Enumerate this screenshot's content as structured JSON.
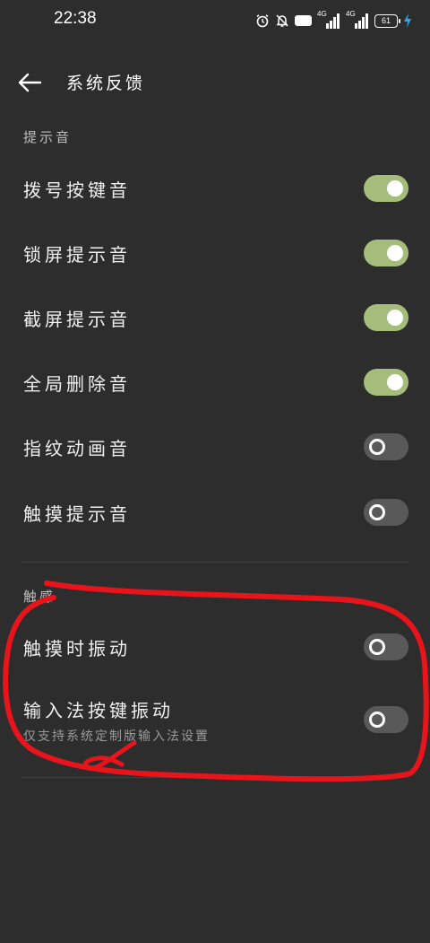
{
  "status_bar": {
    "time": "22:38",
    "icons": [
      "alarm-icon",
      "mute-icon",
      "hd-icon",
      "signal-4g-icon",
      "signal-4g-icon",
      "battery-icon",
      "charging-icon"
    ],
    "hd_label": "HD",
    "network_label_1": "4G",
    "network_label_2": "4G",
    "battery_level": "61"
  },
  "header": {
    "back_icon": "arrow-left-icon",
    "title": "系统反馈"
  },
  "sections": {
    "sound": {
      "label": "提示音",
      "items": [
        {
          "label": "拨号按键音",
          "enabled": true
        },
        {
          "label": "锁屏提示音",
          "enabled": true
        },
        {
          "label": "截屏提示音",
          "enabled": true
        },
        {
          "label": "全局删除音",
          "enabled": true
        },
        {
          "label": "指纹动画音",
          "enabled": false
        },
        {
          "label": "触摸提示音",
          "enabled": false
        }
      ]
    },
    "haptic": {
      "label": "触感",
      "items": [
        {
          "label": "触摸时振动",
          "enabled": false
        },
        {
          "label": "输入法按键振动",
          "sublabel": "仅支持系统定制版输入法设置",
          "enabled": false
        }
      ]
    }
  },
  "colors": {
    "background": "#2d2d2d",
    "toggle_on": "#a4bd7a",
    "toggle_off": "#595959",
    "annotation": "#e8141c"
  }
}
